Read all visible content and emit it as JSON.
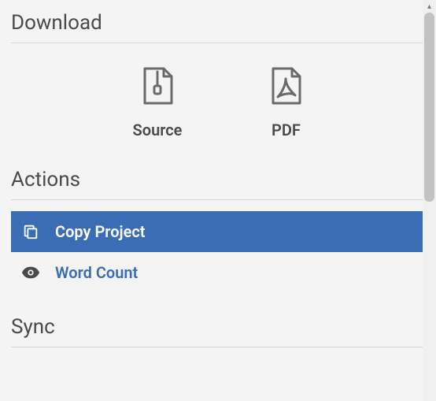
{
  "sections": {
    "download": {
      "title": "Download",
      "source_label": "Source",
      "pdf_label": "PDF"
    },
    "actions": {
      "title": "Actions",
      "items": [
        {
          "label": "Copy Project"
        },
        {
          "label": "Word Count"
        }
      ]
    },
    "sync": {
      "title": "Sync"
    }
  },
  "colors": {
    "accent": "#3b6db4",
    "text": "#4a4a4a",
    "icon": "#6a6a6a"
  }
}
